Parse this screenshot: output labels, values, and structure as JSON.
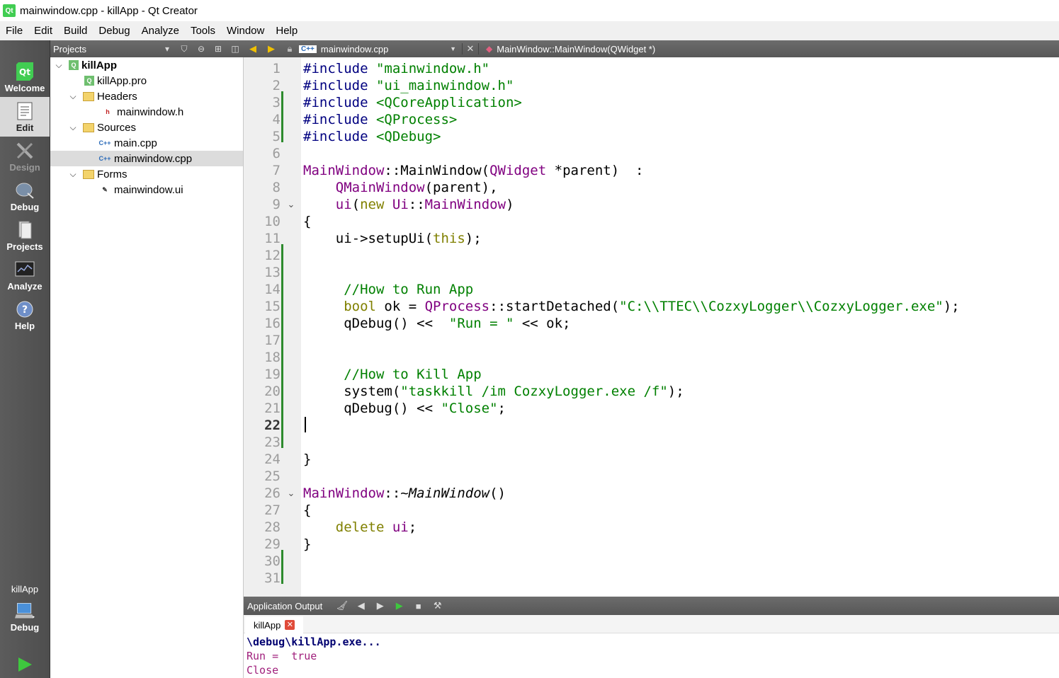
{
  "window": {
    "title": "mainwindow.cpp - killApp - Qt Creator",
    "app_icon": "Qt"
  },
  "menubar": [
    "File",
    "Edit",
    "Build",
    "Debug",
    "Analyze",
    "Tools",
    "Window",
    "Help"
  ],
  "modes": [
    {
      "label": "Welcome",
      "icon": "qt-logo-icon"
    },
    {
      "label": "Edit",
      "icon": "edit-document-icon",
      "active": true
    },
    {
      "label": "Design",
      "icon": "design-tools-icon",
      "disabled": true
    },
    {
      "label": "Debug",
      "icon": "debug-bug-icon"
    },
    {
      "label": "Projects",
      "icon": "projects-icon"
    },
    {
      "label": "Analyze",
      "icon": "analyze-monitor-icon"
    },
    {
      "label": "Help",
      "icon": "help-icon"
    }
  ],
  "kit": {
    "project": "killApp",
    "config": "Debug",
    "run_icon": "run-triangle-icon"
  },
  "projects_panel": {
    "title": "Projects",
    "tree": [
      {
        "label": "killApp",
        "level": 0,
        "type": "project",
        "expanded": true,
        "bold": true
      },
      {
        "label": "killApp.pro",
        "level": 1,
        "type": "pro"
      },
      {
        "label": "Headers",
        "level": 1,
        "type": "folder",
        "expanded": true
      },
      {
        "label": "mainwindow.h",
        "level": 2,
        "type": "header"
      },
      {
        "label": "Sources",
        "level": 1,
        "type": "folder",
        "expanded": true
      },
      {
        "label": "main.cpp",
        "level": 2,
        "type": "cpp"
      },
      {
        "label": "mainwindow.cpp",
        "level": 2,
        "type": "cpp",
        "selected": true
      },
      {
        "label": "Forms",
        "level": 1,
        "type": "folder",
        "expanded": true
      },
      {
        "label": "mainwindow.ui",
        "level": 2,
        "type": "ui"
      }
    ]
  },
  "editor_toolbar": {
    "file": "mainwindow.cpp",
    "file_badge": "C++",
    "symbol": "MainWindow::MainWindow(QWidget *)"
  },
  "editor": {
    "current_line": 22,
    "line_numbers": [
      "1",
      "2",
      "3",
      "4",
      "5",
      "6",
      "7",
      "8",
      "9",
      "10",
      "11",
      "12",
      "13",
      "14",
      "15",
      "16",
      "17",
      "18",
      "19",
      "20",
      "21",
      "22",
      "23",
      "24",
      "25",
      "26",
      "27",
      "28",
      "29",
      "30",
      "31"
    ],
    "lines": {
      "l1": [
        "#include ",
        "\"mainwindow.h\""
      ],
      "l2": [
        "#include ",
        "\"ui_mainwindow.h\""
      ],
      "l3": [
        "#include ",
        "<QCoreApplication>"
      ],
      "l4": [
        "#include ",
        "<QProcess>"
      ],
      "l5": [
        "#include ",
        "<QDebug>"
      ],
      "l7": [
        "MainWindow",
        "::MainWindow(",
        "QWidget",
        " *parent)  :"
      ],
      "l8": [
        "    ",
        "QMainWindow",
        "(parent),"
      ],
      "l9": [
        "    ",
        "ui",
        "(",
        "new",
        " ",
        "Ui",
        "::",
        "MainWindow",
        ")"
      ],
      "l10": "{",
      "l11": [
        "    ui->setupUi(",
        "this",
        ");"
      ],
      "l14": "     //How to Run App",
      "l15": [
        "     ",
        "bool",
        " ok = ",
        "QProcess",
        "::startDetached(",
        "\"C:\\\\TTEC\\\\CozxyLogger\\\\CozxyLogger.exe\"",
        ");"
      ],
      "l16": [
        "     qDebug() <<  ",
        "\"Run = \"",
        " << ok;"
      ],
      "l19": "     //How to Kill App",
      "l20": [
        "     system(",
        "\"taskkill /im CozxyLogger.exe /f\"",
        ");"
      ],
      "l21": [
        "     qDebug() << ",
        "\"Close\"",
        ";"
      ],
      "l24": "}",
      "l26": [
        "MainWindow",
        "::~",
        "MainWindow",
        "()"
      ],
      "l27": "{",
      "l28": [
        "    ",
        "delete",
        " ",
        "ui",
        ";"
      ],
      "l29": "}"
    }
  },
  "output_pane": {
    "title": "Application Output",
    "tab": "killApp",
    "lines": [
      "\\debug\\killApp.exe...",
      "Run =  true",
      "Close"
    ]
  },
  "colors": {
    "include": "#000080",
    "string": "#008000",
    "class": "#800080",
    "keyword": "#808000",
    "change_bar": "#2e8b2e",
    "output_text": "#a0207c"
  }
}
